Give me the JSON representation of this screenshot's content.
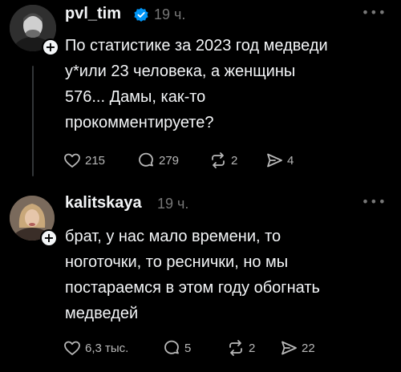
{
  "posts": [
    {
      "username": "pvl_tim",
      "verified": true,
      "time": "19 ч.",
      "text": "По статистике за 2023 год медведи\nу*или 23 человека, а женщины\n576... Дамы, как-то\nпрокомментируете?",
      "likes": "215",
      "replies": "279",
      "reposts": "2",
      "shares": "4"
    },
    {
      "username": "kalitskaya",
      "verified": false,
      "time": "19 ч.",
      "text": "брат, у нас мало времени, то\nноготочки, то реснички, но мы\nпостараемся в этом году обогнать\nмедведей",
      "likes": "6,3 тыс.",
      "replies": "5",
      "reposts": "2",
      "shares": "22"
    }
  ],
  "more_label": "•••",
  "follow_label": "+",
  "colors": {
    "background": "#000000",
    "text": "#f3f5f7",
    "muted": "#777777",
    "verified": "#0095f6"
  }
}
